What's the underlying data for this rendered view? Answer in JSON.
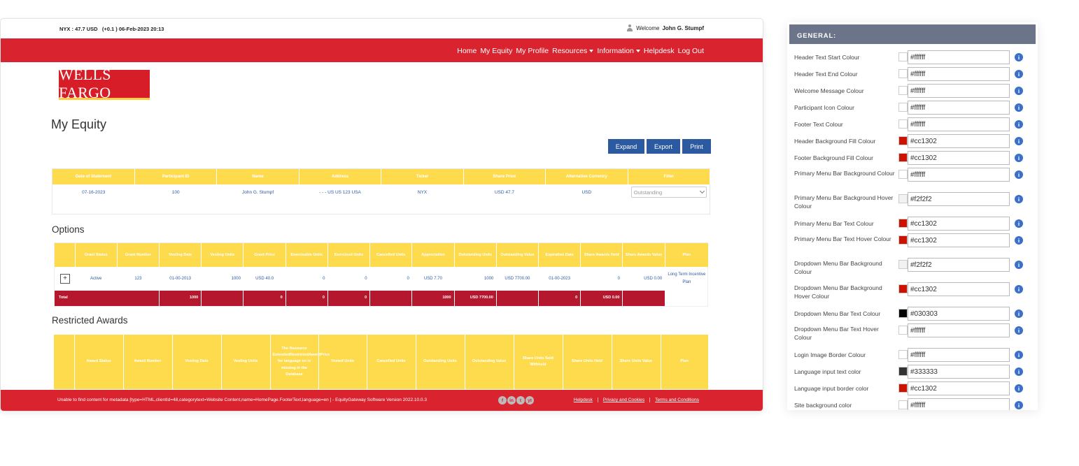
{
  "portal": {
    "topbar": {
      "ticker": "NYX : 47.7 USD   (+0.1 ) 06-Feb-2023 20:13",
      "welcome_prefix": "Welcome",
      "user_name": "John G. Stumpf"
    },
    "menu": [
      {
        "label": "Home",
        "dropdown": false
      },
      {
        "label": "My Equity",
        "dropdown": false
      },
      {
        "label": "My Profile",
        "dropdown": false
      },
      {
        "label": "Resources",
        "dropdown": true
      },
      {
        "label": "Information",
        "dropdown": true
      },
      {
        "label": "Helpdesk",
        "dropdown": false
      },
      {
        "label": "Log Out",
        "dropdown": false
      }
    ],
    "logo_text": "WELLS FARGO",
    "page_title": "My Equity",
    "actions": {
      "expand": "Expand",
      "export": "Export",
      "print": "Print"
    },
    "summary": {
      "headers": [
        "Date of Statement",
        "Participant ID",
        "Name",
        "Address",
        "Ticker",
        "Share Price",
        "Alternative Currency",
        "Filter"
      ],
      "row": [
        "07-16-2023",
        "100",
        "John G. Stumpf",
        "- - - US US 123 USA",
        "NYX",
        "USD 47.7",
        "USD"
      ],
      "filter_value": "Outstanding"
    },
    "options": {
      "title": "Options",
      "headers": [
        "",
        "Grant Status",
        "Grant Number",
        "Vesting Date",
        "Vesting Units",
        "Grant Price",
        "Exercisable Units",
        "Exercised Units",
        "Cancelled Units",
        "Appreciation",
        "Outstanding Units",
        "Outstanding Value",
        "Expiration Date",
        "Share Awards Held",
        "Share Awards Value",
        "Plan"
      ],
      "row": [
        "Active",
        "123",
        "01-00-2013",
        "1000",
        "USD 40.0",
        "0",
        "0",
        "0",
        "USD 7.70",
        "1000",
        "USD 7700.00",
        "01-00-2023",
        "0",
        "USD 0.00",
        "Long Term Incentive Plan"
      ],
      "expand_symbol": "+",
      "total": [
        "Total",
        "",
        "",
        "1000",
        "",
        "0",
        "0",
        "0",
        "",
        "1000",
        "USD 7700.00",
        "",
        "0",
        "USD 0.00",
        ""
      ]
    },
    "restricted": {
      "title": "Restricted Awards",
      "headers": [
        "",
        "Award Status",
        "Award Number",
        "Vesting Date",
        "Vesting Units",
        "The Resource ExtendedRestrictedAwardPrice for language en is missing in the Database",
        "Vested Units",
        "Cancelled Units",
        "Outstanding Units",
        "Outstanding Value",
        "Share Units Sold Withheld",
        "Share Units Held",
        "Share Units Value",
        "Plan"
      ]
    },
    "footer": {
      "text": "Unable to find content for metadata [type=HTML,clientId=48,categorytext=Website Content,name=HomePage.FooterText,language=en ] - EquityGateway Software Version 2022.10.0.3",
      "social": [
        "f",
        "in",
        "t",
        "yt"
      ],
      "links": [
        "Helpdesk",
        "Privacy and Cookies",
        "Terms and Conditions"
      ]
    }
  },
  "settings": {
    "title": "GENERAL:",
    "rows": [
      {
        "label": "Header Text Start Colour",
        "value": "#ffffff",
        "swatch": "#ffffff"
      },
      {
        "label": "Header Text End Colour",
        "value": "#ffffff",
        "swatch": "#ffffff"
      },
      {
        "label": "Welcome Message Colour",
        "value": "#ffffff",
        "swatch": "#ffffff"
      },
      {
        "label": "Participant Icon Colour",
        "value": "#ffffff",
        "swatch": "#ffffff"
      },
      {
        "label": "Footer Text Colour",
        "value": "#ffffff",
        "swatch": "#ffffff"
      },
      {
        "label": "Header Background Fill Colour",
        "value": "#cc1302",
        "swatch": "#cc1302"
      },
      {
        "label": "Footer Background Fill Colour",
        "value": "#cc1302",
        "swatch": "#cc1302"
      },
      {
        "label": "Primary Menu Bar Background Colour",
        "value": "#ffffff",
        "swatch": "#ffffff"
      },
      {
        "label": "Primary Menu Bar Background Hover Colour",
        "value": "#f2f2f2",
        "swatch": "#f2f2f2"
      },
      {
        "label": "Primary Menu Bar Text Colour",
        "value": "#cc1302",
        "swatch": "#cc1302"
      },
      {
        "label": "Primary Menu Bar Text Hover Colour",
        "value": "#cc1302",
        "swatch": "#cc1302"
      },
      {
        "label": "Dropdown Menu Bar Background Colour",
        "value": "#f2f2f2",
        "swatch": "#f2f2f2"
      },
      {
        "label": "Dropdown Menu Bar Background Hover Colour",
        "value": "#cc1302",
        "swatch": "#cc1302"
      },
      {
        "label": "Dropdown Menu Bar Text Colour",
        "value": "#030303",
        "swatch": "#030303"
      },
      {
        "label": "Dropdown Menu Bar Text Hover Colour",
        "value": "#ffffff",
        "swatch": "#ffffff"
      },
      {
        "label": "Login Image Border Colour",
        "value": "#ffffff",
        "swatch": "#ffffff"
      },
      {
        "label": "Language input text color",
        "value": "#333333",
        "swatch": "#333333"
      },
      {
        "label": "Language input border color",
        "value": "#cc1302",
        "swatch": "#cc1302"
      },
      {
        "label": "Site background color",
        "value": "#ffffff",
        "swatch": "#ffffff"
      }
    ],
    "info_symbol": "i"
  }
}
